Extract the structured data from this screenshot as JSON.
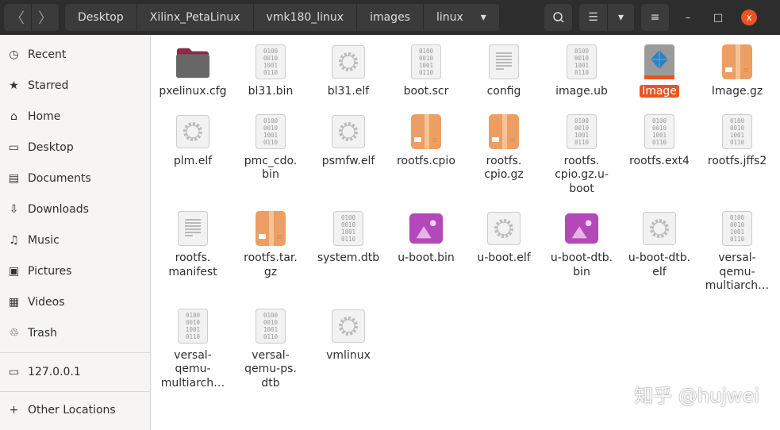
{
  "nav": {
    "back": "〈",
    "forward": "〉"
  },
  "breadcrumbs": [
    "Desktop",
    "Xilinx_PetaLinux",
    "vmk180_linux",
    "images",
    "linux"
  ],
  "toolbar": {
    "search_icon": "search-icon",
    "dropdown": "▾",
    "list_icon": "list-view-icon",
    "menu_icon": "hamburger-menu-icon",
    "minimize": "–",
    "maximize": "□",
    "close": "x"
  },
  "sidebar": {
    "items": [
      {
        "label": "Recent",
        "icon": "◷"
      },
      {
        "label": "Starred",
        "icon": "★"
      },
      {
        "label": "Home",
        "icon": "⌂"
      },
      {
        "label": "Desktop",
        "icon": "▭"
      },
      {
        "label": "Documents",
        "icon": "▤"
      },
      {
        "label": "Downloads",
        "icon": "⇩"
      },
      {
        "label": "Music",
        "icon": "♫"
      },
      {
        "label": "Pictures",
        "icon": "▣"
      },
      {
        "label": "Videos",
        "icon": "▦"
      },
      {
        "label": "Trash",
        "icon": "♲"
      }
    ],
    "network": {
      "label": "127.0.0.1",
      "icon": "▭"
    },
    "other": {
      "label": "Other Locations",
      "icon": "+"
    }
  },
  "files": [
    {
      "name": "pxelinux.cfg",
      "type": "folder"
    },
    {
      "name": "bl31.bin",
      "type": "binary"
    },
    {
      "name": "bl31.elf",
      "type": "exec"
    },
    {
      "name": "boot.scr",
      "type": "binary"
    },
    {
      "name": "config",
      "type": "text"
    },
    {
      "name": "image.ub",
      "type": "binary"
    },
    {
      "name": "Image",
      "type": "xilinx",
      "selected": true
    },
    {
      "name": "Image.gz",
      "type": "archive"
    },
    {
      "name": "plm.elf",
      "type": "exec"
    },
    {
      "name": "pmc_cdo.\nbin",
      "type": "binary"
    },
    {
      "name": "psmfw.elf",
      "type": "exec"
    },
    {
      "name": "rootfs.cpio",
      "type": "archive"
    },
    {
      "name": "rootfs.\ncpio.gz",
      "type": "archive"
    },
    {
      "name": "rootfs.\ncpio.gz.u-\nboot",
      "type": "binary"
    },
    {
      "name": "rootfs.ext4",
      "type": "binary"
    },
    {
      "name": "rootfs.jffs2",
      "type": "binary"
    },
    {
      "name": "rootfs.\nmanifest",
      "type": "text"
    },
    {
      "name": "rootfs.tar.\ngz",
      "type": "archive"
    },
    {
      "name": "system.dtb",
      "type": "binary"
    },
    {
      "name": "u-boot.bin",
      "type": "image"
    },
    {
      "name": "u-boot.elf",
      "type": "exec"
    },
    {
      "name": "u-boot-dtb.\nbin",
      "type": "image"
    },
    {
      "name": "u-boot-dtb.\nelf",
      "type": "exec"
    },
    {
      "name": "versal-\nqemu-\nmultiarch…",
      "type": "binary"
    },
    {
      "name": "versal-\nqemu-\nmultiarch…",
      "type": "binary"
    },
    {
      "name": "versal-\nqemu-ps.\ndtb",
      "type": "binary"
    },
    {
      "name": "vmlinux",
      "type": "exec"
    }
  ],
  "binary_glyph": "0100\n0010\n1001\n0110",
  "watermark": "知乎 @hujwei",
  "colors": {
    "accent": "#e95420",
    "header": "#2d2d2d"
  }
}
